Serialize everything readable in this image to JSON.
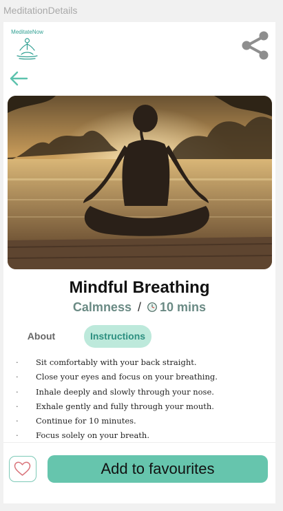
{
  "frame": {
    "label": "MeditationDetails"
  },
  "header": {
    "logo_text": "MeditateNow"
  },
  "meditation": {
    "title": "Mindful Breathing",
    "category": "Calmness",
    "separator": "/",
    "duration": "10 mins"
  },
  "tabs": [
    {
      "label": "About",
      "active": false
    },
    {
      "label": "Instructions",
      "active": true
    }
  ],
  "instructions": [
    "Sit comfortably with your back straight.",
    "Close your eyes and focus on your breathing.",
    "Inhale deeply and slowly through your nose.",
    "Exhale gently and fully through your mouth.",
    "Continue for 10 minutes.",
    "Focus solely on your breath."
  ],
  "bullet": "·",
  "footer": {
    "add_favourites_label": "Add to favourites"
  },
  "colors": {
    "accent": "#66c5ad",
    "tab_active_bg": "#bde9db",
    "tab_active_text": "#2d8f80",
    "category_text": "#6a8a84"
  },
  "icons": [
    "share-icon",
    "back-arrow-icon",
    "clock-icon",
    "heart-icon",
    "meditation-figure-icon"
  ]
}
